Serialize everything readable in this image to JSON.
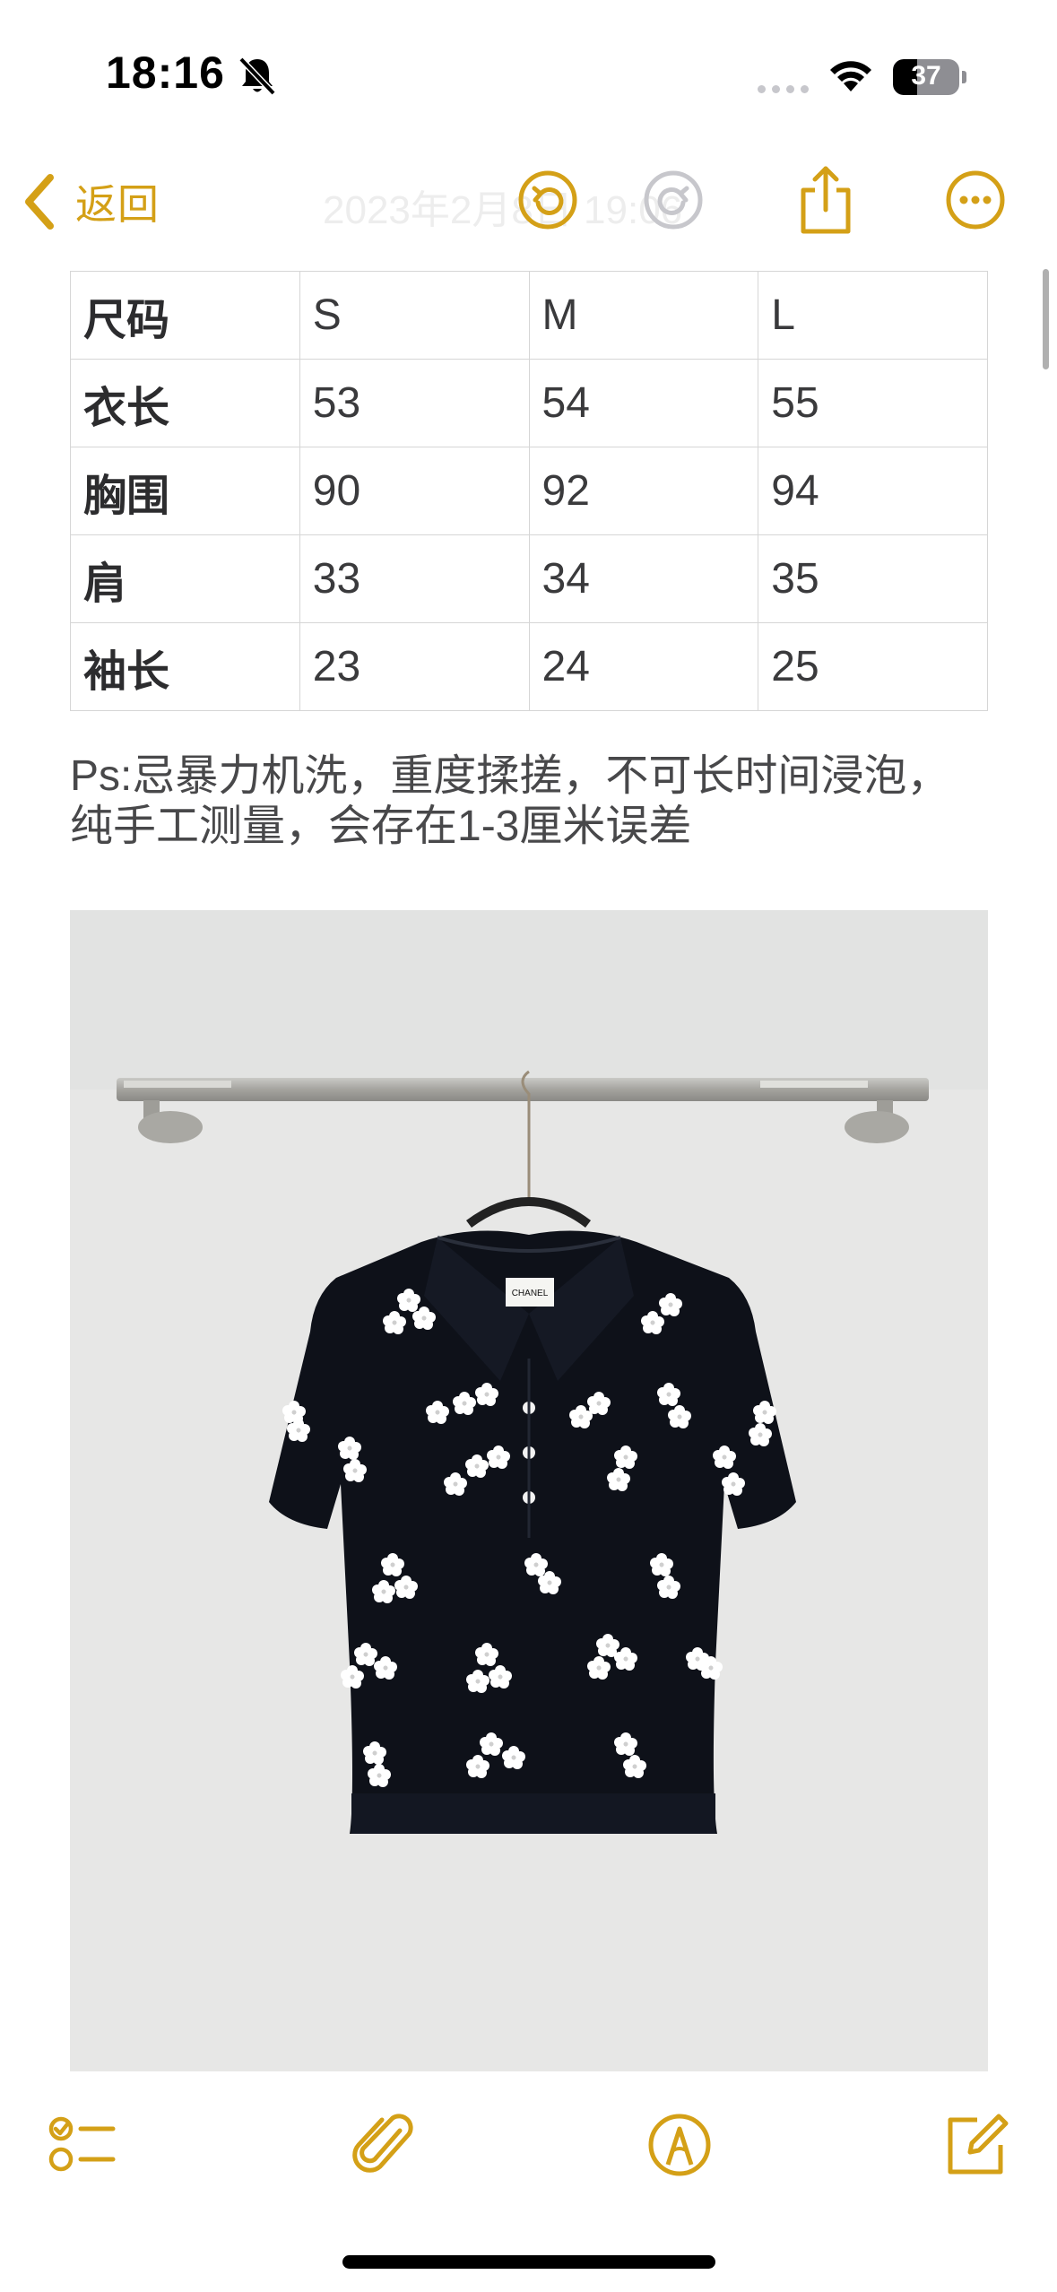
{
  "status_bar": {
    "time": "18:16",
    "battery_text": "37",
    "battery_level": 0.37,
    "icons": [
      "bell-slash-icon",
      "signal-icon",
      "wifi-icon",
      "battery-icon"
    ]
  },
  "nav": {
    "back_label": "返回",
    "date_text": "2023年2月8日 19:06",
    "accent_color": "#d4a017",
    "icons": [
      "chevron-left-icon",
      "undo-icon",
      "redo-icon",
      "share-icon",
      "more-icon"
    ]
  },
  "size_table": {
    "rows": [
      [
        "尺码",
        "S",
        "M",
        "L"
      ],
      [
        "衣长",
        "53",
        "54",
        "55"
      ],
      [
        "胸围",
        "90",
        "92",
        "94"
      ],
      [
        "肩",
        "33",
        "34",
        "35"
      ],
      [
        "袖长",
        "23",
        "24",
        "25"
      ]
    ]
  },
  "note": {
    "line1": "Ps:忌暴力机洗，重度揉搓，不可长时间浸泡，",
    "line2": "纯手工测量，会存在1-3厘米误差"
  },
  "photo": {
    "label_text": "CHANEL"
  },
  "toolbar": {
    "icons": [
      "checklist-icon",
      "paperclip-icon",
      "markup-pen-icon",
      "compose-icon"
    ]
  }
}
